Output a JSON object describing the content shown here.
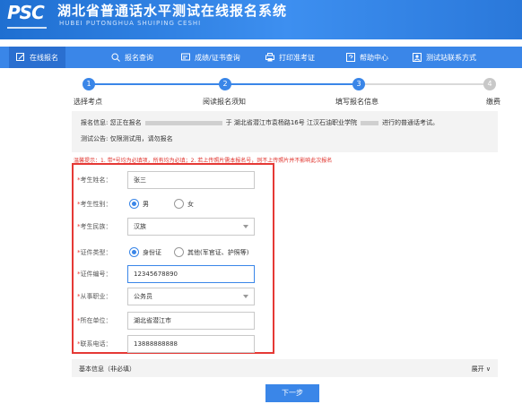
{
  "header": {
    "logo": "PSC",
    "title": "湖北省普通话水平测试在线报名系统",
    "subtitle": "HUBEI PUTONGHUA SHUIPING CESHI"
  },
  "nav": {
    "items": [
      {
        "label": "在线报名",
        "icon": "edit-icon"
      },
      {
        "label": "报名查询",
        "icon": "search-icon"
      },
      {
        "label": "成绩/证书查询",
        "icon": "certificate-icon"
      },
      {
        "label": "打印准考证",
        "icon": "printer-icon"
      },
      {
        "label": "帮助中心",
        "icon": "help-icon"
      },
      {
        "label": "测试站联系方式",
        "icon": "contact-icon"
      }
    ]
  },
  "steps": [
    {
      "num": "1",
      "label": "选择考点"
    },
    {
      "num": "2",
      "label": "阅读报名须知"
    },
    {
      "num": "3",
      "label": "填写报名信息"
    },
    {
      "num": "4",
      "label": "缴费"
    }
  ],
  "info": {
    "line1_prefix": "报名信息: 您正在报名",
    "line1_mid": "于",
    "line1_suffix": "湖北省潜江市袁杨路16号 江汉石油职业学院",
    "line1_end": "进行的普通话考试。",
    "line2": "测试公告: 仅限测试用，请勿报名"
  },
  "tip": "温馨提示：1. 带*号均为必填项，所有均为必填；2. 若上传照片需本报名号，则不上传照片并不影响此次报名",
  "form": {
    "name": {
      "label": "考生姓名：",
      "value": "张三"
    },
    "gender": {
      "label": "考生性别：",
      "options": [
        "男",
        "女"
      ],
      "selected": "男"
    },
    "ethnicity": {
      "label": "考生民族：",
      "value": "汉族"
    },
    "id_type": {
      "label": "证件类型：",
      "options": [
        "身份证",
        "其他(军官证、护照等)"
      ],
      "selected": "身份证"
    },
    "id_number": {
      "label": "证件编号：",
      "value": "12345678890"
    },
    "occupation": {
      "label": "从事职业：",
      "value": "公务员"
    },
    "employer": {
      "label": "所在单位：",
      "value": "湖北省潜江市"
    },
    "phone": {
      "label": "联系电话：",
      "value": "13888888888"
    }
  },
  "extra": {
    "label": "基本信息（非必填）",
    "toggle": "展开 ∨"
  },
  "next_button": "下一步",
  "colors": {
    "primary": "#3a86e8",
    "highlight_border": "#e53935",
    "tip": "#e0302a"
  }
}
